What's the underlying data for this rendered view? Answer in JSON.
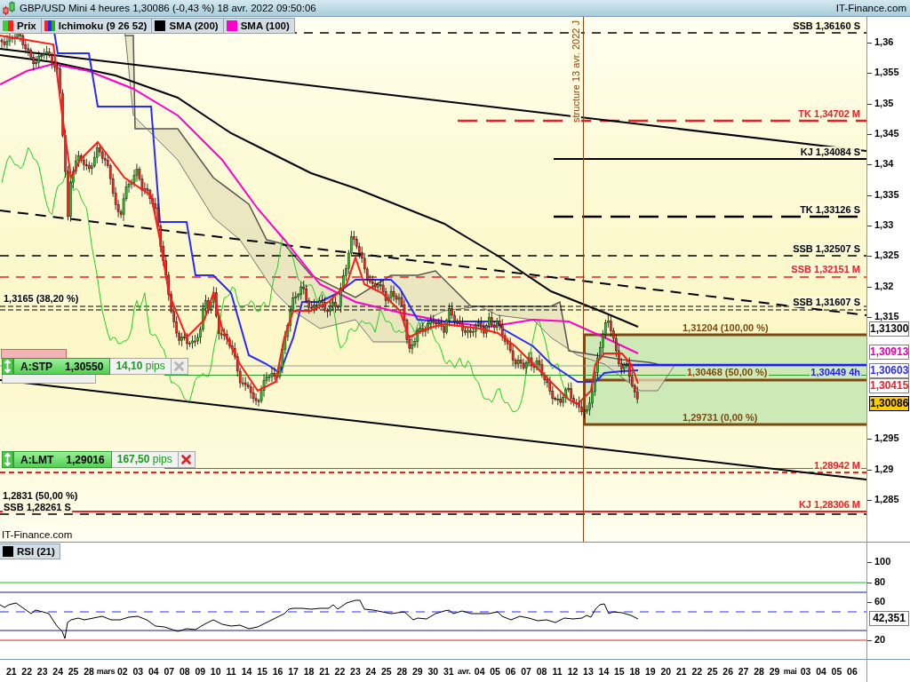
{
  "window": {
    "title": "GBP/USD Mini 4 heures 1,30086 (-0,43 %) 18 avr. 2022 09:50:06",
    "brand": "IT-Finance.com"
  },
  "legend": [
    {
      "label": "Prix",
      "swatch": [
        {
          "color": "#3ccf3c"
        },
        {
          "color": "#ff2020"
        }
      ]
    },
    {
      "label": "Ichimoku (9 26 52)",
      "swatch": [
        {
          "color": "#ff2020"
        },
        {
          "color": "#2a2aff"
        },
        {
          "color": "#20b020"
        }
      ]
    },
    {
      "label": "SMA (200)",
      "swatch": [
        {
          "color": "#000000"
        }
      ]
    },
    {
      "label": "SMA (100)",
      "swatch": [
        {
          "color": "#ff00cc"
        }
      ]
    }
  ],
  "levels": [
    {
      "label": "SSB 1,36160 S",
      "color": "#000000",
      "kind": "dashed"
    },
    {
      "label": "TK 1,34702 M",
      "color": "#e8202a",
      "kind": "long-dashed"
    },
    {
      "label": "KJ 1,34084 S",
      "color": "#000000",
      "kind": "solid"
    },
    {
      "label": "TK 1,33126 S",
      "color": "#000000",
      "kind": "long-dashed"
    },
    {
      "label": "SSB 1,32507 S",
      "color": "#000000",
      "kind": "dashed"
    },
    {
      "label": "SSB 1,32151 M",
      "color": "#e8202a",
      "kind": "dashed"
    },
    {
      "label": "1,3165 (38,20 %)",
      "color": "#000000",
      "kind": "fine-dashed"
    },
    {
      "label": "SSB 1,31607 S",
      "color": "#000000",
      "kind": "fine-dashed"
    },
    {
      "label": "1,28942 M",
      "color": "#e8202a",
      "kind": "dotted"
    },
    {
      "label": "SSB 1,28261 S",
      "color": "#000000",
      "kind": "dashed"
    },
    {
      "label": "KJ 1,28306 M",
      "color": "#e8202a",
      "kind": "solid"
    }
  ],
  "retracement_label": "1,2831 (50,00 %)",
  "fibonacci": [
    "1,31204 (100,00 %)",
    "1,30468 (50,00 %)",
    "1,29731 (0,00 %)"
  ],
  "kijun_label": "1,30449 4h",
  "structure_label": "structure 13 avr. 2022 J",
  "orders": [
    {
      "type": "A:STP",
      "price": "1,30550",
      "distance": "**14,10** pips",
      "disabled": true
    },
    {
      "type": "A:LMT",
      "price": "1,29016",
      "distance": "**167,50** pips",
      "disabled": false
    }
  ],
  "footer_brand": "IT-Finance.com",
  "price_axis": {
    "ticks": [
      "1,36",
      "1,355",
      "1,35",
      "1,345",
      "1,34",
      "1,335",
      "1,33",
      "1,325",
      "1,32",
      "1,315",
      "1,295",
      "1,29",
      "1,285"
    ],
    "tags": [
      {
        "value": "1,31300",
        "color": "#000000",
        "current": false
      },
      {
        "value": "1,30913",
        "color": "#e000b0",
        "current": false
      },
      {
        "value": "1,30603",
        "color": "#2a2aff",
        "current": false
      },
      {
        "value": "1,30415",
        "color": "#e8202a",
        "current": false
      },
      {
        "value": "1,30086",
        "color": "#000000",
        "current": true
      }
    ]
  },
  "rsi": {
    "legend": {
      "label": "RSI (21)",
      "swatch": [
        {
          "color": "#000000"
        }
      ]
    },
    "ticks": [
      "100",
      "80",
      "60",
      "20"
    ],
    "value": "42,351"
  },
  "date_axis": {
    "labels": [
      {
        "label": "21",
        "kind": "day"
      },
      {
        "label": "22",
        "kind": "day"
      },
      {
        "label": "23",
        "kind": "day"
      },
      {
        "label": "24",
        "kind": "day"
      },
      {
        "label": "25",
        "kind": "day"
      },
      {
        "label": "28",
        "kind": "day"
      },
      {
        "label": "mars",
        "kind": "month"
      },
      {
        "label": "02",
        "kind": "day"
      },
      {
        "label": "03",
        "kind": "day"
      },
      {
        "label": "04",
        "kind": "day"
      },
      {
        "label": "07",
        "kind": "day"
      },
      {
        "label": "08",
        "kind": "day"
      },
      {
        "label": "09",
        "kind": "day"
      },
      {
        "label": "10",
        "kind": "day"
      },
      {
        "label": "11",
        "kind": "day"
      },
      {
        "label": "14",
        "kind": "day"
      },
      {
        "label": "15",
        "kind": "day"
      },
      {
        "label": "16",
        "kind": "day"
      },
      {
        "label": "17",
        "kind": "day"
      },
      {
        "label": "18",
        "kind": "day"
      },
      {
        "label": "21",
        "kind": "day"
      },
      {
        "label": "22",
        "kind": "day"
      },
      {
        "label": "23",
        "kind": "day"
      },
      {
        "label": "24",
        "kind": "day"
      },
      {
        "label": "25",
        "kind": "day"
      },
      {
        "label": "28",
        "kind": "day"
      },
      {
        "label": "29",
        "kind": "day"
      },
      {
        "label": "30",
        "kind": "day"
      },
      {
        "label": "31",
        "kind": "day"
      },
      {
        "label": "avr.",
        "kind": "month"
      },
      {
        "label": "04",
        "kind": "day"
      },
      {
        "label": "05",
        "kind": "day"
      },
      {
        "label": "06",
        "kind": "day"
      },
      {
        "label": "07",
        "kind": "day"
      },
      {
        "label": "08",
        "kind": "day"
      },
      {
        "label": "11",
        "kind": "day"
      },
      {
        "label": "12",
        "kind": "day"
      },
      {
        "label": "13",
        "kind": "day"
      },
      {
        "label": "14",
        "kind": "day"
      },
      {
        "label": "15",
        "kind": "day"
      },
      {
        "label": "18",
        "kind": "day"
      },
      {
        "label": "19",
        "kind": "day"
      },
      {
        "label": "20",
        "kind": "day"
      },
      {
        "label": "21",
        "kind": "day"
      },
      {
        "label": "22",
        "kind": "day"
      },
      {
        "label": "25",
        "kind": "day"
      },
      {
        "label": "26",
        "kind": "day"
      },
      {
        "label": "27",
        "kind": "day"
      },
      {
        "label": "28",
        "kind": "day"
      },
      {
        "label": "29",
        "kind": "day"
      },
      {
        "label": "mai",
        "kind": "month"
      },
      {
        "label": "03",
        "kind": "day"
      },
      {
        "label": "04",
        "kind": "day"
      },
      {
        "label": "05",
        "kind": "day"
      },
      {
        "label": "06",
        "kind": "day"
      }
    ]
  }
}
